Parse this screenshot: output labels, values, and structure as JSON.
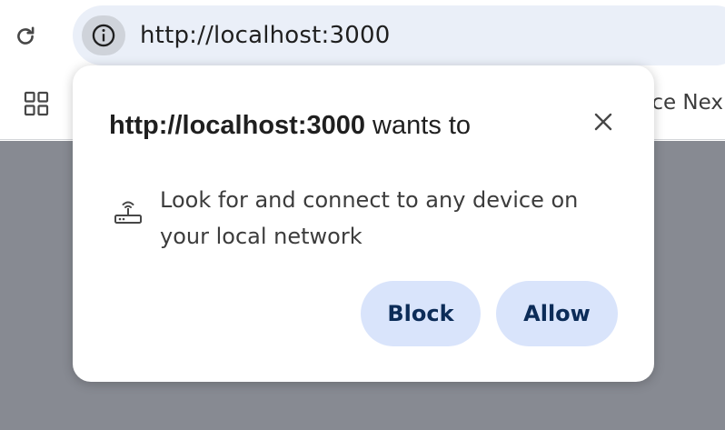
{
  "address_bar": {
    "url": "http://localhost:3000"
  },
  "bookmarks_bar": {
    "partial_item_label": "ce Nex"
  },
  "permission_dialog": {
    "origin": "http://localhost:3000",
    "title_suffix": " wants to",
    "permission_text": "Look for and connect to any device on your local network",
    "block_label": "Block",
    "allow_label": "Allow"
  },
  "icons": {
    "reload": "reload-icon",
    "site_info": "info-icon",
    "apps": "apps-grid-icon",
    "close": "close-icon",
    "permission": "router-icon"
  },
  "colors": {
    "omnibox_bg": "#eaeff8",
    "button_bg": "#d9e4fb",
    "button_text": "#0c2c58",
    "page_overlay": "#878a92"
  }
}
